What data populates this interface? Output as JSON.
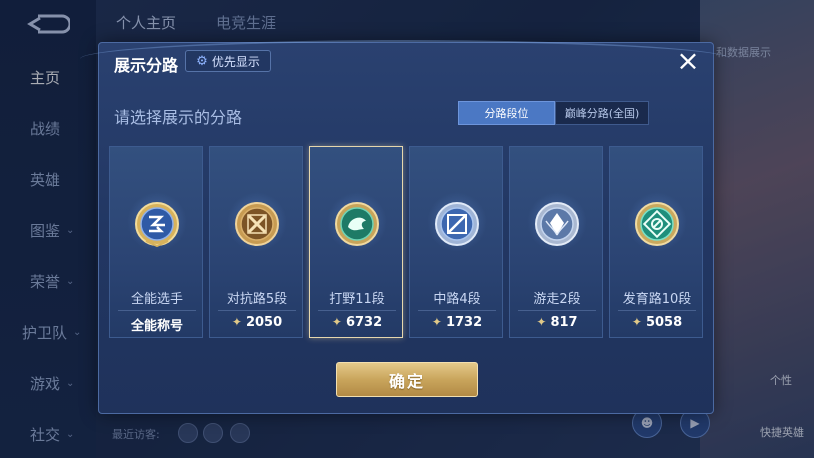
{
  "sidebar": {
    "items": [
      {
        "label": "主页"
      },
      {
        "label": "战绩"
      },
      {
        "label": "英雄"
      },
      {
        "label": "图鉴"
      },
      {
        "label": "荣誉"
      },
      {
        "label": "护卫队"
      },
      {
        "label": "游戏"
      },
      {
        "label": "社交"
      }
    ]
  },
  "top_tabs": [
    "个人主页",
    "电竞生涯"
  ],
  "background": {
    "right_label_1": "和数据展示",
    "recent_visitors": "最近访客:",
    "right_link_1": "个性",
    "right_link_2": "快捷英雄"
  },
  "modal": {
    "title": "展示分路",
    "priority_button": "优先显示",
    "close_icon": "×",
    "subtitle": "请选择展示的分路",
    "segments": [
      "分路段位",
      "巅峰分路(全国)"
    ],
    "cards": [
      {
        "role": "全能选手",
        "stat": "全能称号",
        "has_star": false,
        "selected": false
      },
      {
        "role": "对抗路5段",
        "stat": "2050",
        "has_star": true,
        "selected": false
      },
      {
        "role": "打野11段",
        "stat": "6732",
        "has_star": true,
        "selected": true
      },
      {
        "role": "中路4段",
        "stat": "1732",
        "has_star": true,
        "selected": false
      },
      {
        "role": "游走2段",
        "stat": "817",
        "has_star": true,
        "selected": false
      },
      {
        "role": "发育路10段",
        "stat": "5058",
        "has_star": true,
        "selected": false
      }
    ],
    "confirm_button": "确定"
  },
  "colors": {
    "accent": "#4b78c4",
    "gold": "#c9a55c",
    "selected_border": "#e6d7ad"
  }
}
